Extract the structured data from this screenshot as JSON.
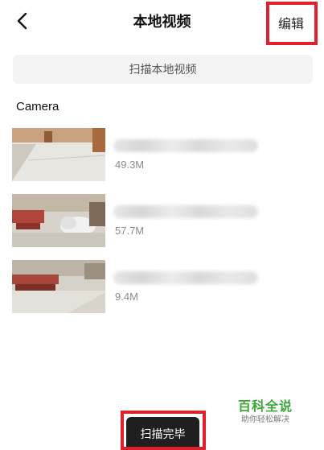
{
  "header": {
    "title": "本地视频",
    "edit_label": "编辑",
    "back_icon": "chevron-left-icon"
  },
  "scan": {
    "label": "扫描本地视频"
  },
  "folder": {
    "name": "Camera"
  },
  "videos": [
    {
      "size": "49.3M"
    },
    {
      "size": "57.7M"
    },
    {
      "size": "9.4M"
    }
  ],
  "toast": {
    "label": "扫描完毕"
  },
  "watermark": {
    "title": "百科全说",
    "subtitle": "助你轻松解决"
  },
  "colors": {
    "highlight": "#e0202a",
    "watermark_green": "#3aa63a",
    "toast_bg": "#1f1f1f"
  }
}
